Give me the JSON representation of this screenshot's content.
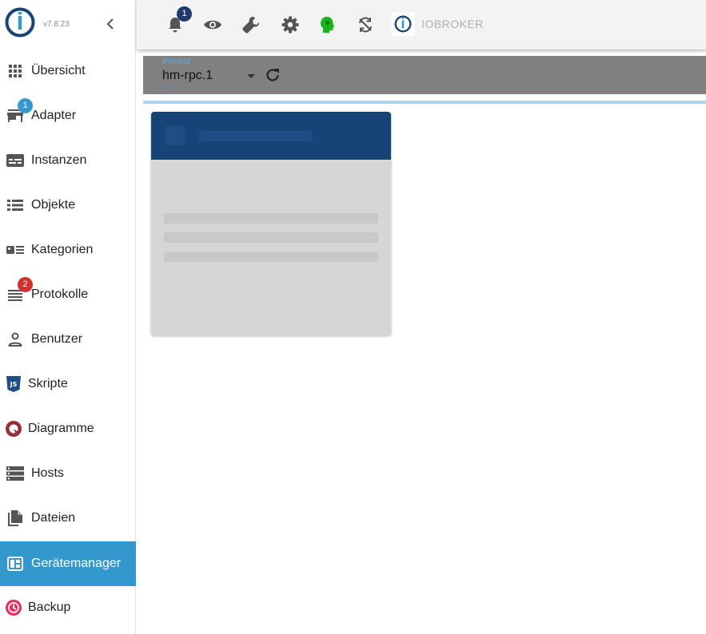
{
  "app": {
    "version": "v7.8.23",
    "brand_name": "IOBROKER"
  },
  "colors": {
    "accent": "#3399cc",
    "card_header": "#164477",
    "alert_red": "#d32f2f",
    "info_blue": "#3399cc",
    "badge_navy": "#1e3a6e",
    "green_icon": "#19b31f"
  },
  "sidebar": {
    "items": [
      {
        "label": "Übersicht",
        "icon": "apps-grid-icon"
      },
      {
        "label": "Adapter",
        "icon": "store-icon",
        "badge": "1"
      },
      {
        "label": "Instanzen",
        "icon": "instances-icon"
      },
      {
        "label": "Objekte",
        "icon": "list-icon"
      },
      {
        "label": "Kategorien",
        "icon": "category-icon"
      },
      {
        "label": "Protokolle",
        "icon": "log-lines-icon",
        "badge": "2"
      },
      {
        "label": "Benutzer",
        "icon": "user-icon"
      },
      {
        "label": "Skripte",
        "icon": "javascript-icon"
      },
      {
        "label": "Diagramme",
        "icon": "chart-icon"
      },
      {
        "label": "Hosts",
        "icon": "server-icon"
      },
      {
        "label": "Dateien",
        "icon": "files-icon"
      },
      {
        "label": "Gerätemanager",
        "icon": "device-manager-icon",
        "active": true
      },
      {
        "label": "Backup",
        "icon": "backup-icon"
      }
    ]
  },
  "topbar": {
    "notifications_count": "1",
    "icons": [
      "bell-icon",
      "eye-icon",
      "wrench-icon",
      "settings-icon",
      "expert-head-icon",
      "sync-icon"
    ]
  },
  "toolbar": {
    "instance_label": "Instanz",
    "instance_value": "hm-rpc.1"
  }
}
